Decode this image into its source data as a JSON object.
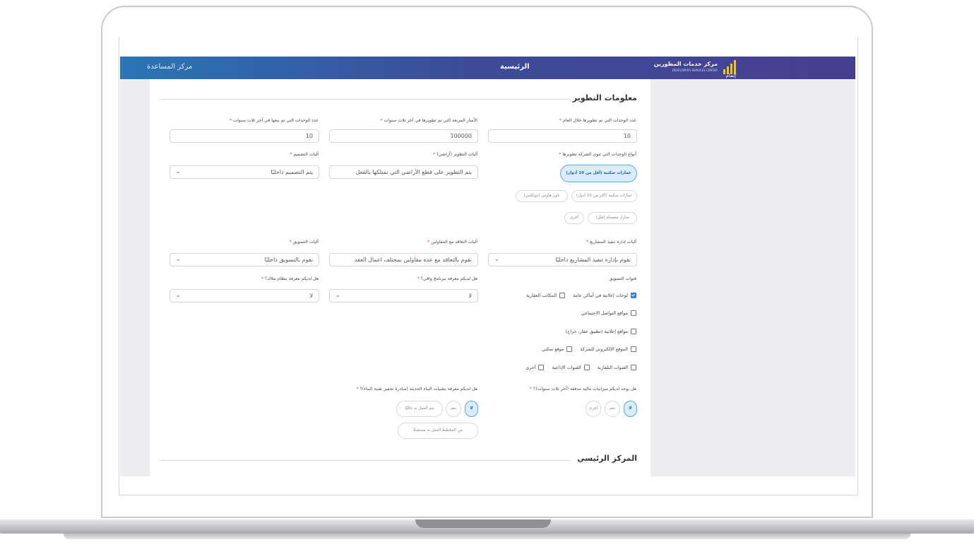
{
  "topbar": {
    "help_label": "مركز المساعدة",
    "home_label": "الرئيسية",
    "brand_name_ar": "مركز خدمات المطورين",
    "brand_name_en": "DEVELOPERS SERVICES CENTER",
    "brand_logo_text": "إتمام",
    "logo_color": "#f0c419"
  },
  "section_title": "معلومات التطوير",
  "section2_title": "المركز الرئيسي",
  "required_mark": "*",
  "fields": {
    "units_year": {
      "label": "عدد الوحدات التي تم تطويرها خلال العام",
      "value": "10"
    },
    "sqm_three_years": {
      "label": "الأمتار المربعة التي تم تطويرها في آخر ثلاث سنوات",
      "value": "100000"
    },
    "units_sold": {
      "label": "عدد الوحدات التي تم بيعها في آخر ثلاث سنوات",
      "value": "10"
    },
    "unit_types_label": "أنواع الوحدات التي تنوي الشركة تطويرها",
    "dev_mechanism": {
      "label": "آليات التطوير (أراضي)",
      "value": "يتم التطوير على قطع الأراضي التي نمتلكها بالفعل"
    },
    "design_mechanism": {
      "label": "آليات التصميم",
      "value": "يتم التصميم داخليًا"
    },
    "project_mgmt": {
      "label": "آليات إدارة تنفيذ المشاريع",
      "value": "نقوم بإدارة تنفيذ المشاريع داخليًا"
    },
    "contracting": {
      "label": "آليات التعاقد مع المقاولين",
      "value": "نقوم بالتعاقد مع عدة مقاولين بمختلف اعمال العقد"
    },
    "marketing": {
      "label": "آليات التسويق",
      "value": "نقوم بالتسويق داخليًا"
    },
    "marketing_channels_label": "قنوات التسويق",
    "wafi": {
      "label": "هل لديكم معرفة ببرنامج وافي؟",
      "value": "لا"
    },
    "mullak": {
      "label": "هل لديكم معرفة بنظام ملاك؟",
      "value": "لا"
    },
    "audited_label": "هل يوجد لديكم ميزانيات مالية مدققة (آخر ثلاث سنوات)؟",
    "tech_label": "هل لديكم معرفة بتقنيات البناء الحديثة (مبادرة تحفيز تقنية البناء)؟"
  },
  "unit_types": [
    "عمارات سكنية (أقل من 10 أدوار)",
    "عمارات سكنية (أكثر من 10 أدوار)",
    "تاون هاوس (دوبلكس)",
    "منازل منفصلة (فلل)",
    "أخرى"
  ],
  "channels": [
    {
      "label": "لوحات إعلانية في أماكن عامة",
      "checked": true
    },
    {
      "label": "المكاتب العقارية",
      "checked": false
    },
    {
      "label": "مواقع التواصل الاجتماعي",
      "checked": false
    },
    {
      "label": "مواقع إعلانية (تطبيق عقار، حراج)",
      "checked": false
    },
    {
      "label": "الموقع الإلكتروني للشركة",
      "checked": false
    },
    {
      "label": "موقع سكني",
      "checked": false
    },
    {
      "label": "القنوات التلفازية",
      "checked": false
    },
    {
      "label": "القنوات الإذاعية",
      "checked": false
    },
    {
      "label": "أخرى",
      "checked": false
    }
  ],
  "audited_options": [
    "لا",
    "نعم",
    "أخرى"
  ],
  "tech_options": [
    "لا",
    "نعم",
    "يتم العمل به حاليًا",
    "من المخطط العمل به مستقبلا"
  ]
}
